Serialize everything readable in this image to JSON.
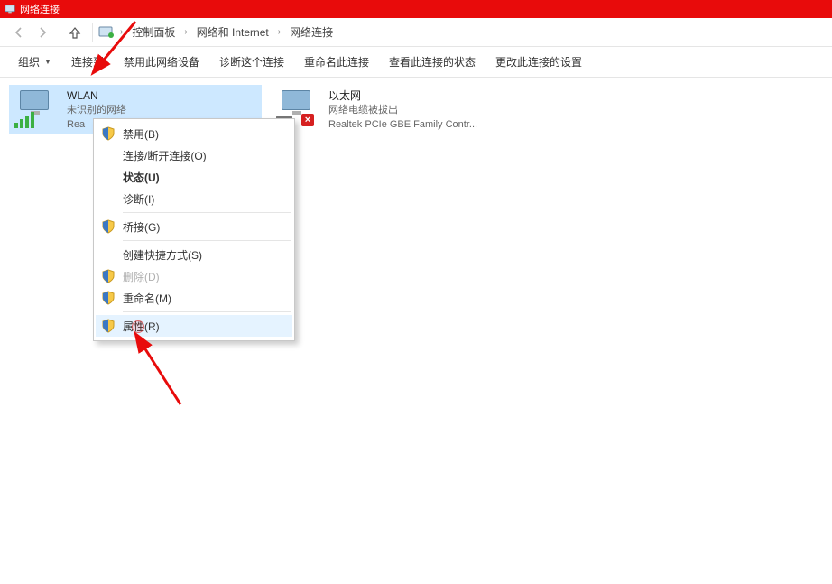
{
  "window": {
    "title": "网络连接"
  },
  "breadcrumb": {
    "items": [
      "控制面板",
      "网络和 Internet",
      "网络连接"
    ]
  },
  "commands": {
    "organize": "组织",
    "connect": "连接到",
    "disable": "禁用此网络设备",
    "diagnose": "诊断这个连接",
    "rename": "重命名此连接",
    "viewstatus": "查看此连接的状态",
    "changesettings": "更改此连接的设置"
  },
  "adapters": {
    "wlan": {
      "name": "WLAN",
      "status": "未识别的网络",
      "device": "Rea"
    },
    "ethernet": {
      "name": "以太网",
      "status": "网络电缆被拔出",
      "device": "Realtek PCIe GBE Family Contr..."
    }
  },
  "contextmenu": {
    "disable": "禁用(B)",
    "connectdisconnect": "连接/断开连接(O)",
    "status": "状态(U)",
    "diagnose": "诊断(I)",
    "bridge": "桥接(G)",
    "shortcut": "创建快捷方式(S)",
    "delete": "删除(D)",
    "rename": "重命名(M)",
    "properties": "属性(R)"
  }
}
